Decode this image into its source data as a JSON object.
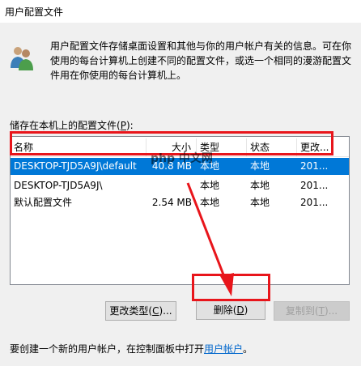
{
  "window": {
    "title": "用户配置文件"
  },
  "description": "用户配置文件存储桌面设置和其他与你的用户帐户有关的信息。可在你使用的每台计算机上创建不同的配置文件，或选一个相同的漫游配置文件用在你使用的每台计算机上。",
  "list": {
    "label_pre": "储存在本机上的配置文件(",
    "label_key": "P",
    "label_post": "):",
    "columns": [
      "名称",
      "大小",
      "类型",
      "状态",
      "更改..."
    ],
    "rows": [
      {
        "name": "DESKTOP-TJD5A9J\\default",
        "size": "40.8 MB",
        "type": "本地",
        "status": "本地",
        "modified": "201..."
      },
      {
        "name": "DESKTOP-TJD5A9J\\",
        "size": "",
        "type": "本地",
        "status": "本地",
        "modified": "201..."
      },
      {
        "name": "默认配置文件",
        "size": "2.54 MB",
        "type": "本地",
        "status": "本地",
        "modified": "201..."
      }
    ]
  },
  "buttons": {
    "change_type": {
      "pre": "更改类型(",
      "key": "C",
      "post": ")..."
    },
    "delete": {
      "pre": "删除(",
      "key": "D",
      "post": ")"
    },
    "copy_to": {
      "pre": "复制到(",
      "key": "T",
      "post": ")..."
    }
  },
  "footer": {
    "text": "要创建一个新的用户帐户，在控制面板中打开",
    "link": "用户帐户",
    "end": "。"
  },
  "watermark": "php 中文网",
  "colors": {
    "selection": "#0078d7",
    "highlight": "#e8151b",
    "link": "#0066cc"
  }
}
